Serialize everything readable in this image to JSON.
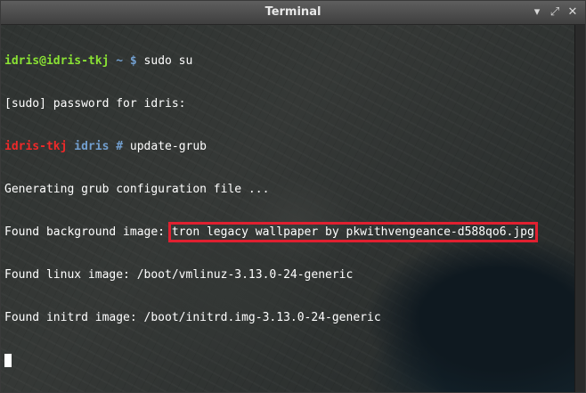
{
  "window": {
    "title": "Terminal",
    "buttons": {
      "minimize_glyph": "▾",
      "maximize_glyph": "⤢",
      "close_glyph": "✕"
    }
  },
  "terminal": {
    "line1": {
      "user_host": "idris@idris-tkj",
      "path": "~ $",
      "command": "sudo su"
    },
    "line2": {
      "text": "[sudo] password for idris:"
    },
    "line3": {
      "host": "idris-tkj",
      "path": "idris #",
      "command": "update-grub"
    },
    "line4": {
      "text": "Generating grub configuration file ..."
    },
    "line5": {
      "prefix": "Found background image: ",
      "filename": "tron legacy wallpaper by pkwithvengeance-d588qo6.jpg"
    },
    "line6": {
      "text": "Found linux image: /boot/vmlinuz-3.13.0-24-generic"
    },
    "line7": {
      "text": "Found initrd image: /boot/initrd.img-3.13.0-24-generic"
    }
  },
  "colors": {
    "prompt_user": "#8ae234",
    "prompt_path": "#729fcf",
    "root_host": "#ef2929",
    "highlight_box": "#e02030"
  }
}
